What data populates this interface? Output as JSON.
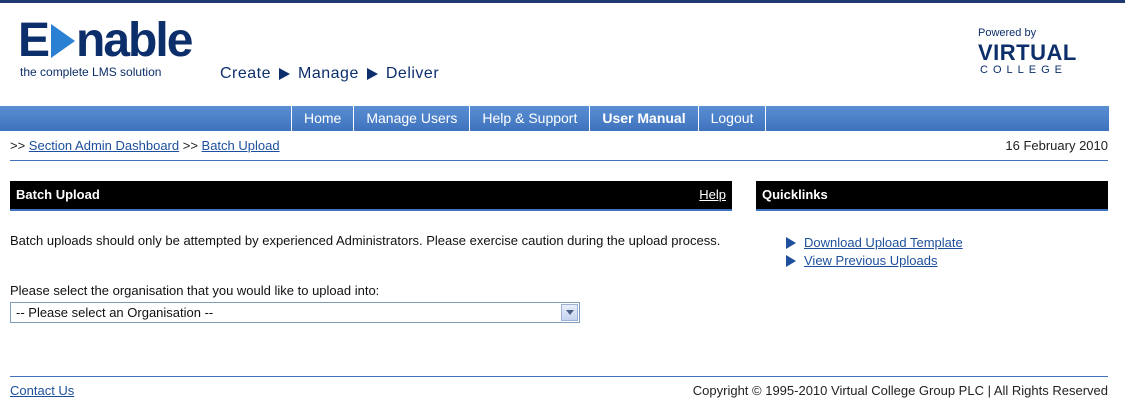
{
  "brand": {
    "logo_e": "E",
    "logo_rest": "nable",
    "tagline": "the complete LMS solution",
    "slogan": [
      "Create",
      "Manage",
      "Deliver"
    ],
    "powered_by": "Powered by",
    "virtual": "VIRTUAL",
    "college": "COLLEGE",
    "colors": {
      "navy": "#0c2f6b",
      "accent": "#2a80d2",
      "nav": "#4a80c8"
    }
  },
  "nav": {
    "items": [
      {
        "label": "Home",
        "active": false
      },
      {
        "label": "Manage Users",
        "active": false
      },
      {
        "label": "Help & Support",
        "active": false
      },
      {
        "label": "User Manual",
        "active": true
      },
      {
        "label": "Logout",
        "active": false
      }
    ]
  },
  "breadcrumb": {
    "prefix1": ">> ",
    "item1": "Section Admin Dashboard",
    "prefix2": " >> ",
    "item2": "Batch Upload"
  },
  "date": "16 February 2010",
  "main": {
    "title": "Batch Upload",
    "help": "Help",
    "intro": "Batch uploads should only be attempted by experienced Administrators. Please exercise caution during the upload process.",
    "select_label": "Please select the organisation that you would like to upload into:",
    "select_value": "-- Please select an Organisation --"
  },
  "quicklinks": {
    "title": "Quicklinks",
    "items": [
      "Download Upload Template",
      "View Previous Uploads"
    ]
  },
  "footer": {
    "contact": "Contact Us",
    "copyright": "Copyright © 1995-2010 Virtual College Group PLC | All Rights Reserved"
  }
}
